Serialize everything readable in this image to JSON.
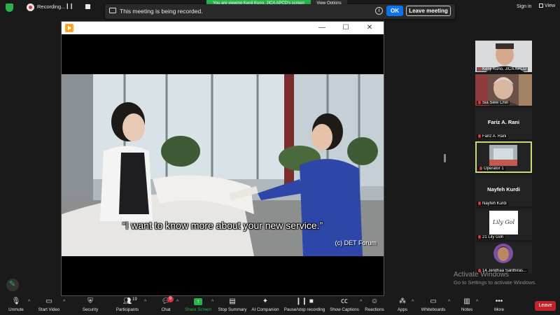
{
  "topbar": {
    "recording_label": "Recording...",
    "share_banner": "You are viewing Kenji Kuno, JICA APCD's screen",
    "view_options": "View Options",
    "sign_in": "Sign in",
    "view": "View"
  },
  "notice": {
    "text": "This meeting is being recorded.",
    "ok": "OK",
    "leave_meeting": "Leave meeting"
  },
  "video": {
    "subtitle": "“I want to know more about your new service.”",
    "credit": "(c) DET Forum"
  },
  "participants": [
    {
      "name": "Kenji Kuno, JICA APCD",
      "type": "video"
    },
    {
      "name": "Sia Siew Chin",
      "type": "video"
    },
    {
      "name": "Fariz A. Rani",
      "display": "Fariz A. Rani",
      "type": "name"
    },
    {
      "name": "Operator 1",
      "type": "video",
      "active": true
    },
    {
      "name": "Nayfeh Kurdi",
      "display": "Nayfeh Kurdi",
      "type": "name"
    },
    {
      "name": "21 Lily Goh",
      "logo": "Lily Gol",
      "type": "logo"
    },
    {
      "name": "14 Jenithaa Santhiras...",
      "type": "video"
    }
  ],
  "activate_windows": {
    "title": "Activate Windows",
    "subtitle": "Go to Settings to activate Windows."
  },
  "toolbar": {
    "unmute": "Unmute",
    "start_video": "Start Video",
    "security": "Security",
    "participants": "Participants",
    "participants_count": "19",
    "chat": "Chat",
    "chat_badge": "9",
    "share_screen": "Share Screen",
    "stop_summary": "Stop Summary",
    "ai_companion": "AI Companion",
    "pause_stop_recording": "Pause/stop recording",
    "show_captions": "Show Captions",
    "reactions": "Reactions",
    "apps": "Apps",
    "whiteboards": "Whiteboards",
    "notes": "Notes",
    "more": "More",
    "leave": "Leave"
  },
  "colors": {
    "accent_green": "#2bb24c",
    "ok_blue": "#0e72ed",
    "leave_red": "#c0252d",
    "active_tile_border": "#c7d97a"
  }
}
